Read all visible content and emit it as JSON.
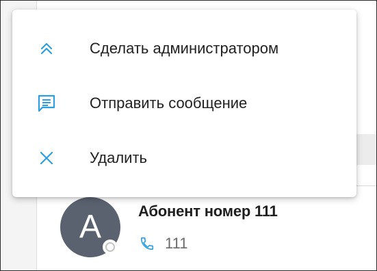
{
  "colors": {
    "accent": "#2d9fe0",
    "avatar_bg": "#5a6270",
    "menu_bg": "#ffffff"
  },
  "context_menu": {
    "items": [
      {
        "label": "Сделать администратором",
        "icon": "double-chevron-up-icon"
      },
      {
        "label": "Отправить сообщение",
        "icon": "message-icon"
      },
      {
        "label": "Удалить",
        "icon": "close-icon"
      }
    ]
  },
  "contact": {
    "avatar_letter": "A",
    "name": "Абонент номер 111",
    "phone": "111",
    "phone_icon": "phone-icon",
    "status": "offline"
  }
}
